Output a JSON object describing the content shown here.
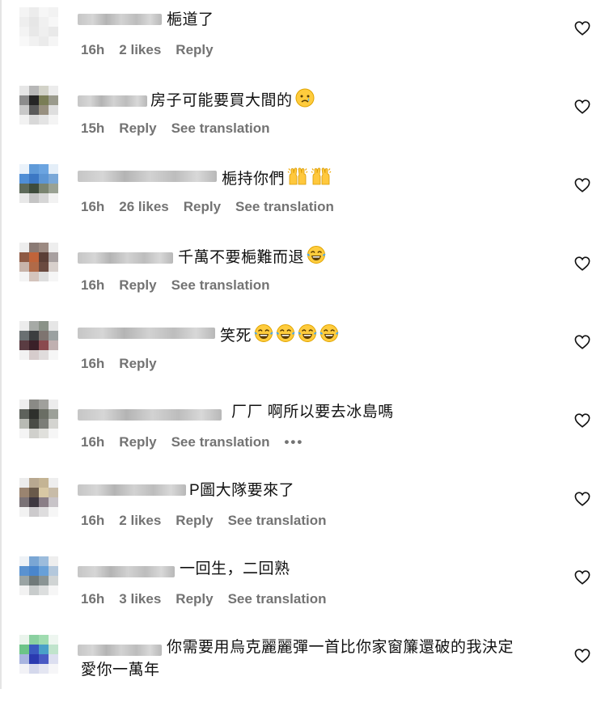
{
  "comments": [
    {
      "text": "梔道了",
      "time": "16h",
      "likes": "2 likes",
      "reply": "Reply"
    },
    {
      "text": "房子可能要買大間的",
      "time": "15h",
      "reply": "Reply",
      "translate": "See translation"
    },
    {
      "text": "梔持你們",
      "time": "16h",
      "likes": "26 likes",
      "reply": "Reply",
      "translate": "See translation"
    },
    {
      "text": "千萬不要梔難而退",
      "time": "16h",
      "reply": "Reply",
      "translate": "See translation"
    },
    {
      "text": "笑死",
      "time": "16h",
      "reply": "Reply"
    },
    {
      "text": "厂厂 啊所以要去冰島嗎",
      "time": "16h",
      "reply": "Reply",
      "translate": "See translation",
      "more": "•••"
    },
    {
      "text": "P圖大隊要來了",
      "time": "16h",
      "likes": "2 likes",
      "reply": "Reply",
      "translate": "See translation"
    },
    {
      "text": "一回生，二回熟",
      "time": "16h",
      "likes": "3 likes",
      "reply": "Reply",
      "translate": "See translation"
    },
    {
      "text_line1": "你需要用烏克麗麗彈一首比你家窗簾還破的我決定",
      "text_line2": "愛你一萬年"
    }
  ],
  "emojis": {
    "c1": "crying-face",
    "c2": "raising-hands",
    "c3": "tears-of-joy",
    "c4": "tears-of-joy"
  },
  "icons": {
    "heart": "heart-outline-icon",
    "more": "more-horizontal-icon"
  },
  "colors": {
    "meta": "#737373",
    "text": "#111111"
  }
}
